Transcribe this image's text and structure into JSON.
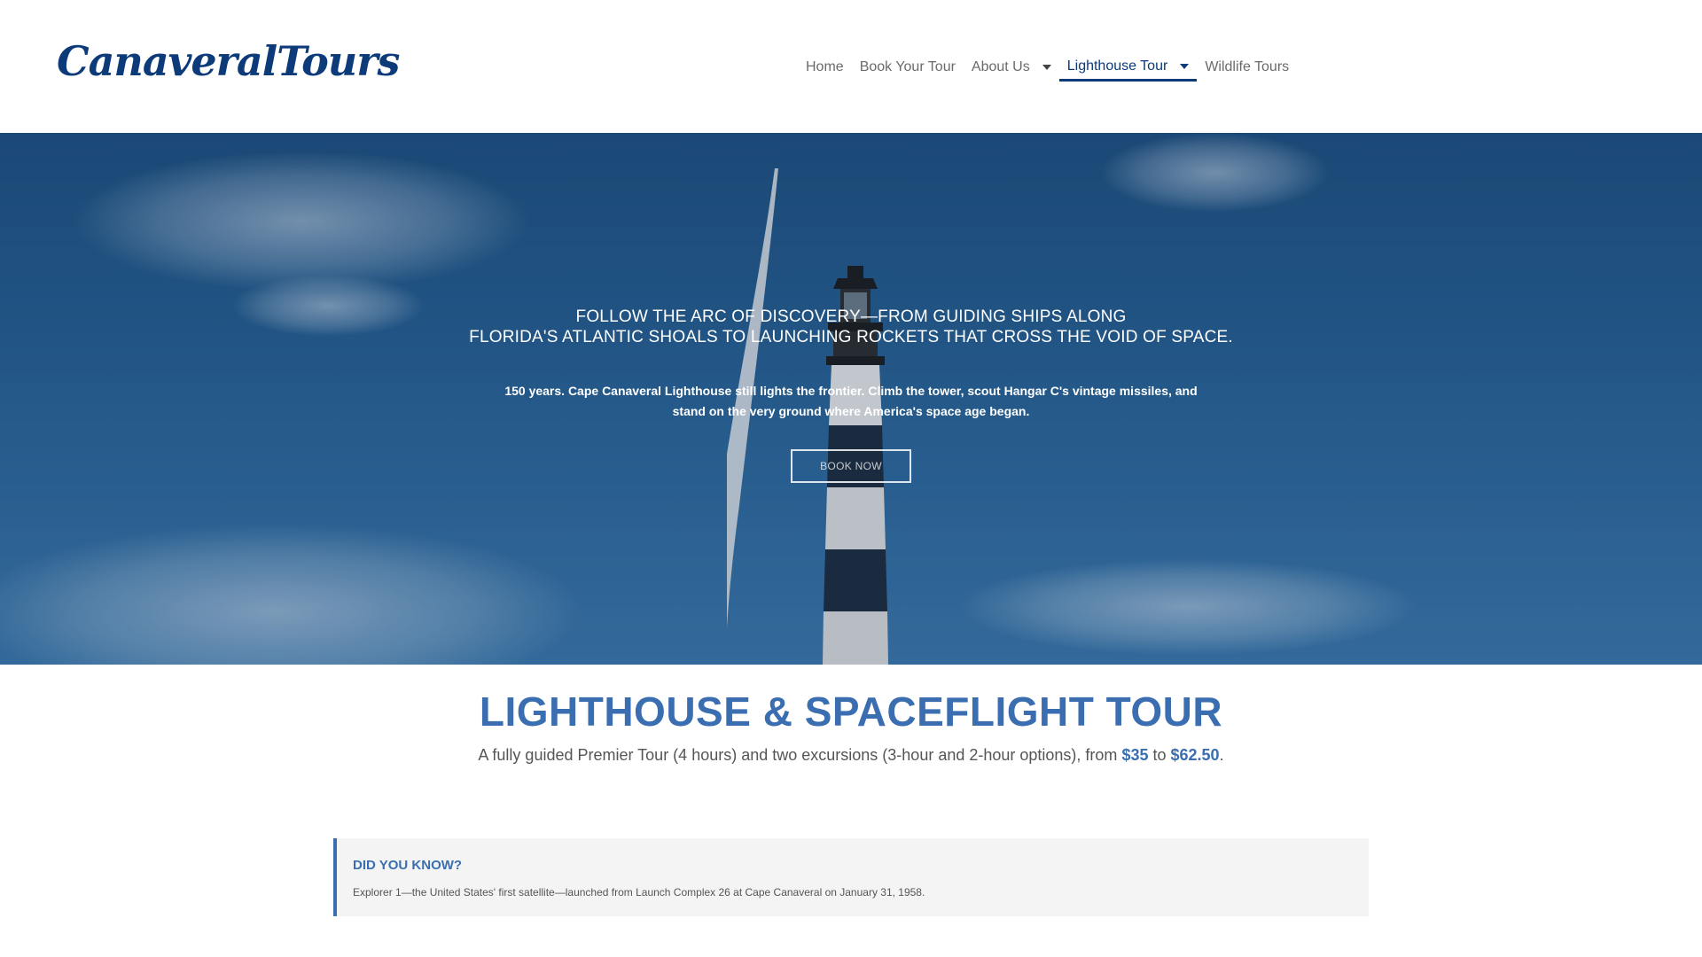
{
  "brand": {
    "logo_text": "CanaveralTours"
  },
  "nav": {
    "items": [
      {
        "label": "Home",
        "has_dropdown": false,
        "active": false
      },
      {
        "label": "Book Your Tour",
        "has_dropdown": false,
        "active": false
      },
      {
        "label": "About Us",
        "has_dropdown": true,
        "active": false
      },
      {
        "label": "Lighthouse Tour",
        "has_dropdown": true,
        "active": true
      },
      {
        "label": "Wildlife Tours",
        "has_dropdown": false,
        "active": false
      }
    ]
  },
  "hero": {
    "headline_line1": "FOLLOW THE ARC OF DISCOVERY—FROM GUIDING SHIPS ALONG",
    "headline_line2": "FLORIDA'S ATLANTIC SHOALS TO LAUNCHING ROCKETS THAT CROSS THE VOID OF SPACE.",
    "subtext_line1": "150 years. Cape Canaveral Lighthouse still lights the frontier. Climb the tower, scout Hangar C's vintage missiles, and",
    "subtext_line2": "stand on the very ground where America's space age began.",
    "button_label": "BOOK NOW"
  },
  "tour": {
    "title": "LIGHTHOUSE & SPACEFLIGHT TOUR",
    "desc_prefix": "A fully guided Premier Tour (4 hours) and two excursions (3-hour and 2-hour options), from ",
    "price_low": "$35",
    "desc_mid": " to ",
    "price_high": "$62.50",
    "desc_suffix": "."
  },
  "did_you_know": {
    "title": "DID YOU KNOW?",
    "text": "Explorer 1—the United States' first satellite—launched from Launch Complex 26 at Cape Canaveral on January 31, 1958."
  },
  "colors": {
    "brand_blue": "#0d3b7a",
    "accent_blue": "#3a6eb0",
    "callout_bg": "#f4f4f4"
  }
}
